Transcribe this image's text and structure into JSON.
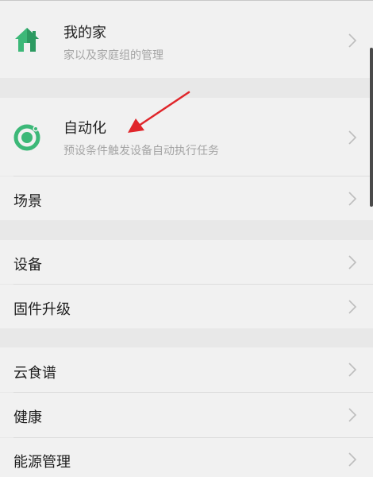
{
  "menu": {
    "home": {
      "label": "我的家",
      "subtitle": "家以及家庭组的管理",
      "icon": "house-icon"
    },
    "automation": {
      "label": "自动化",
      "subtitle": "预设条件触发设备自动执行任务",
      "icon": "automation-ring-icon"
    },
    "scene": {
      "label": "场景"
    },
    "device": {
      "label": "设备"
    },
    "firmware": {
      "label": "固件升级"
    },
    "recipes": {
      "label": "云食谱"
    },
    "health": {
      "label": "健康"
    },
    "energy": {
      "label": "能源管理"
    }
  },
  "colors": {
    "accent_green": "#3cb878",
    "annotation_red": "#e0262b",
    "background": "#e8e8e8",
    "card": "#f1f1f1"
  }
}
